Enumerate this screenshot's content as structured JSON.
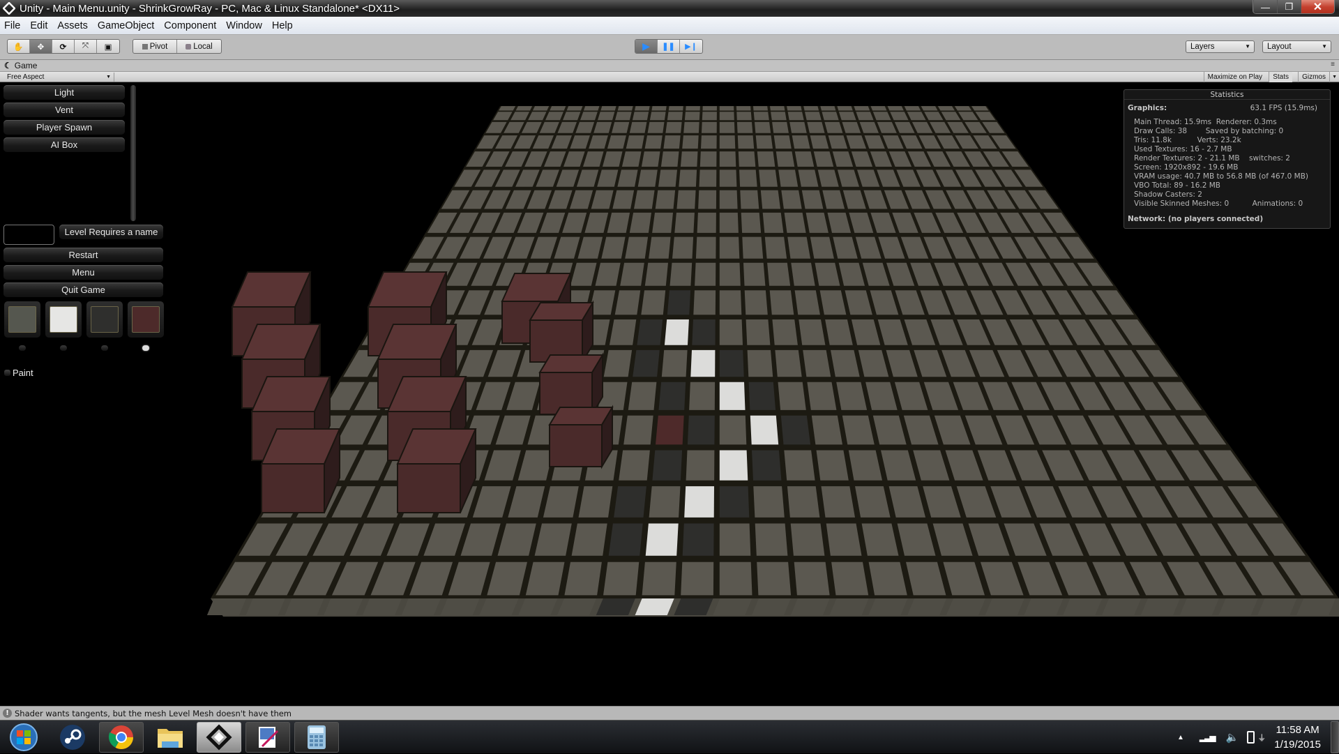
{
  "window": {
    "title": "Unity - Main Menu.unity - ShrinkGrowRay - PC, Mac & Linux Standalone* <DX11>",
    "buttons": {
      "minimize": "—",
      "maximize": "❐",
      "close": "✕"
    }
  },
  "menu": [
    "File",
    "Edit",
    "Assets",
    "GameObject",
    "Component",
    "Window",
    "Help"
  ],
  "toolbar": {
    "tools": [
      {
        "name": "hand-tool",
        "icon": "✋"
      },
      {
        "name": "move-tool",
        "icon": "✥"
      },
      {
        "name": "rotate-tool",
        "icon": "⟳"
      },
      {
        "name": "scale-tool",
        "icon": "⤧"
      },
      {
        "name": "rect-tool",
        "icon": "▣"
      }
    ],
    "pivot_label": "Pivot",
    "local_label": "Local",
    "play_icon": "▶",
    "pause_icon": "❚❚",
    "step_icon": "▶❙",
    "layers_label": "Layers",
    "layout_label": "Layout"
  },
  "game_panel": {
    "tab_label": "Game",
    "aspect": "Free Aspect",
    "maximize_on_play": "Maximize on Play",
    "stats": "Stats",
    "gizmos": "Gizmos"
  },
  "game_gui": {
    "object_buttons": [
      "Light",
      "Vent",
      "Player Spawn",
      "AI Box"
    ],
    "level_name_value": "",
    "level_name_button": "Level Requires a name",
    "menu_buttons": [
      "Restart",
      "Menu",
      "Quit Game"
    ],
    "swatches": [
      {
        "name": "gray-tile",
        "color": "#55574f"
      },
      {
        "name": "white-tile",
        "color": "#e6e6e4"
      },
      {
        "name": "dark-tile",
        "color": "#2f2f2d"
      },
      {
        "name": "red-tile",
        "color": "#4d2a2a"
      }
    ],
    "selected_swatch": 3,
    "paint_label": "Paint",
    "paint_checked": false
  },
  "statistics": {
    "title": "Statistics",
    "graphics_label": "Graphics:",
    "fps": "63.1 FPS (15.9ms)",
    "lines": [
      "Main Thread: 15.9ms  Renderer: 0.3ms",
      "Draw Calls: 38        Saved by batching: 0",
      "Tris: 11.8k           Verts: 23.2k",
      "Used Textures: 16 - 2.7 MB",
      "Render Textures: 2 - 21.1 MB    switches: 2",
      "Screen: 1920x892 - 19.6 MB",
      "VRAM usage: 40.7 MB to 56.8 MB (of 467.0 MB)",
      "VBO Total: 89 - 16.2 MB",
      "Shadow Casters: 2",
      "Visible Skinned Meshes: 0          Animations: 0"
    ],
    "network": "Network: (no players connected)"
  },
  "scene": {
    "floor_color": "#5b5850",
    "grout_color": "#1c1a12",
    "white_tile": "#dcdcda",
    "dark_tile": "#2e2e2c",
    "red_tile": "#4e2a2a",
    "cube_top": "#5a3434",
    "cube_front": "#4a2a2a",
    "cube_side": "#2e1c1c"
  },
  "status": {
    "message": "Shader wants tangents, but the mesh Level Mesh doesn't have them"
  },
  "taskbar": {
    "apps": [
      "start",
      "steam",
      "chrome",
      "file-explorer",
      "unity",
      "paint",
      "calculator"
    ],
    "time": "11:58 AM",
    "date": "1/19/2015"
  }
}
